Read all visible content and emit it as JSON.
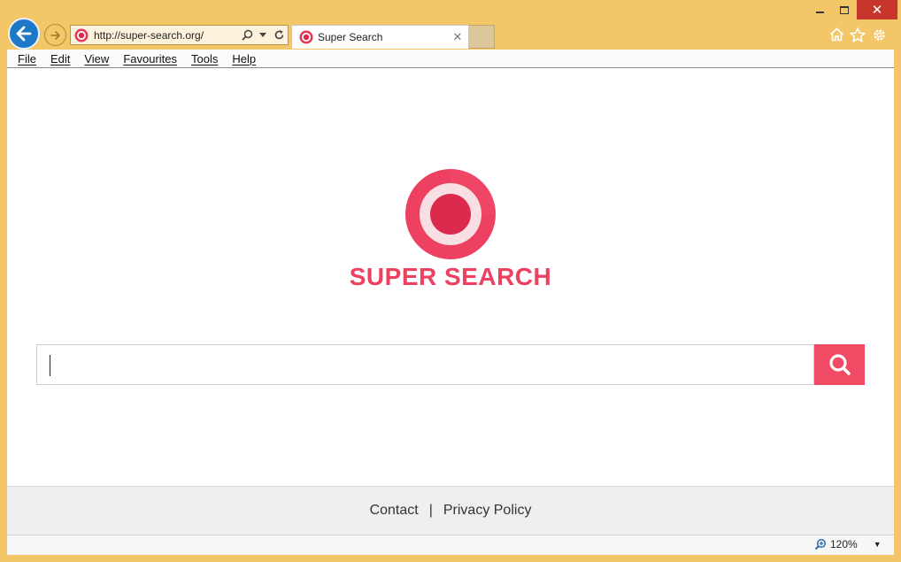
{
  "window": {
    "minimize_icon": "minimize-icon",
    "maximize_icon": "maximize-icon",
    "close_label": "✕"
  },
  "address_bar": {
    "url": "http://super-search.org/",
    "search_icon": "search-icon",
    "dropdown_icon": "chevron-down-icon",
    "refresh_icon": "refresh-icon"
  },
  "tab": {
    "title": "Super Search",
    "close_label": "✕"
  },
  "menu": {
    "items": [
      "File",
      "Edit",
      "View",
      "Favourites",
      "Tools",
      "Help"
    ]
  },
  "page": {
    "logo_text": "SUPER SEARCH",
    "search_value": "",
    "footer": {
      "contact": "Contact",
      "separator": "|",
      "privacy": "Privacy Policy"
    }
  },
  "status": {
    "zoom": "120%"
  },
  "colors": {
    "frame": "#f3c667",
    "brand": "#ee4060",
    "brand_dark": "#dc2a4c",
    "back_button": "#1e78c8",
    "close_button": "#c7352d"
  }
}
